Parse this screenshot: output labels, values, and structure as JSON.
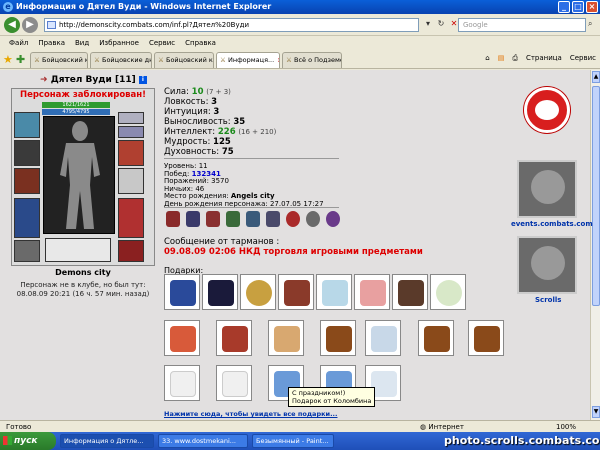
{
  "window": {
    "title": "Информация о Дятел Вуди - Windows Internet Explorer",
    "controls": [
      "_",
      "□",
      "×"
    ]
  },
  "address": {
    "url": "http://demonscity.combats.com/inf.pl?Дятел%20Вуди",
    "search_placeholder": "Google"
  },
  "menu": [
    "Файл",
    "Правка",
    "Вид",
    "Избранное",
    "Сервис",
    "Справка"
  ],
  "tabs": [
    {
      "label": "Бойцовский клуб"
    },
    {
      "label": "Бойцовские дн..."
    },
    {
      "label": "Бойцовский клуб"
    },
    {
      "label": "Информаця..."
    },
    {
      "label": "Всё о Подземе..."
    }
  ],
  "toolbar": {
    "page": "Страница",
    "tools": "Сервис"
  },
  "character": {
    "name": "Дятел Вуди",
    "level_badge": "[11]",
    "blocked": "Персонаж заблокирован!",
    "hp": "1621/1621",
    "mp": "4795/4795",
    "city": "Demons city",
    "club_note_1": "Персонаж не в клубе, но был тут:",
    "club_note_2": "08.08.09 20:21 (16 ч. 57 мин. назад)"
  },
  "stats": [
    {
      "label": "Сила:",
      "value": "10",
      "extra": "(7 + 3)",
      "green": true
    },
    {
      "label": "Ловкость:",
      "value": "3",
      "extra": "",
      "green": false
    },
    {
      "label": "Интуиция:",
      "value": "3",
      "extra": "",
      "green": false
    },
    {
      "label": "Выносливость:",
      "value": "35",
      "extra": "",
      "green": false
    },
    {
      "label": "Интеллект:",
      "value": "226",
      "extra": "(16 + 210)",
      "green": true
    },
    {
      "label": "Мудрость:",
      "value": "125",
      "extra": "",
      "green": false
    },
    {
      "label": "Духовность:",
      "value": "75",
      "extra": "",
      "green": false
    }
  ],
  "info": {
    "level": "Уровень: 11",
    "wins_label": "Побед:",
    "wins": "132341",
    "losses": "Поражений: 3570",
    "draws": "Ничьих: 46",
    "birthplace_label": "Место рождения:",
    "birthplace": "Angels city",
    "birthday": "День рождения персонажа: 27.07.05 17:27"
  },
  "messages": {
    "header": "Сообщение от тарманов :",
    "text": "09.08.09 02:06 НКД торговля игровыми предметами"
  },
  "gifts": {
    "header": "Подарки:",
    "tooltip_1": "С праздником!)",
    "tooltip_2": "Подарок от Коломбина",
    "see_more": "Нажмите сюда, чтобы увидеть все подарки..."
  },
  "sidebar": {
    "events_label": "events.combats.com",
    "scrolls_label": "Scrolls"
  },
  "status": {
    "done": "Готово",
    "zone": "Интернет",
    "zoom": "100%"
  },
  "taskbar": {
    "start": "пуск",
    "tasks": [
      "Информация о Дятле...",
      "33. www.dostmekani...",
      "Безымянный - Paint..."
    ]
  },
  "watermark": "photo.scrolls.combats.com",
  "colors": {
    "blocked": "#dd0000",
    "highlight_stat": "#1a8a1a",
    "link_blue": "#0000cc"
  }
}
